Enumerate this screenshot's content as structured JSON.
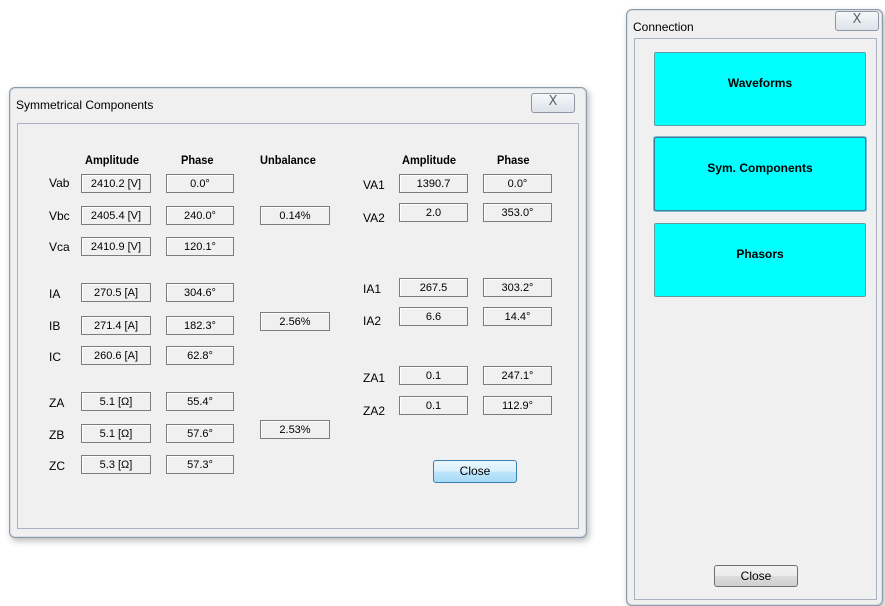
{
  "sym_window": {
    "title": "Symmetrical Components",
    "close_x": "X",
    "headers": {
      "amplitude": "Amplitude",
      "phase": "Phase",
      "unbalance": "Unbalance",
      "amplitude2": "Amplitude",
      "phase2": "Phase"
    },
    "left_rows": [
      {
        "label": "Vab",
        "amplitude": "2410.2 [V]",
        "phase": "0.0°"
      },
      {
        "label": "Vbc",
        "amplitude": "2405.4 [V]",
        "phase": "240.0°"
      },
      {
        "label": "Vca",
        "amplitude": "2410.9 [V]",
        "phase": "120.1°"
      },
      {
        "label": "IA",
        "amplitude": "270.5 [A]",
        "phase": "304.6°"
      },
      {
        "label": "IB",
        "amplitude": "271.4 [A]",
        "phase": "182.3°"
      },
      {
        "label": "IC",
        "amplitude": "260.6 [A]",
        "phase": "62.8°"
      },
      {
        "label": "ZA",
        "amplitude": "5.1 [Ω]",
        "phase": "55.4°"
      },
      {
        "label": "ZB",
        "amplitude": "5.1 [Ω]",
        "phase": "57.6°"
      },
      {
        "label": "ZC",
        "amplitude": "5.3 [Ω]",
        "phase": "57.3°"
      }
    ],
    "unbalance": {
      "voltage": "0.14%",
      "current": "2.56%",
      "impedance": "2.53%"
    },
    "right_rows": [
      {
        "label": "VA1",
        "amplitude": "1390.7",
        "phase": "0.0°"
      },
      {
        "label": "VA2",
        "amplitude": "2.0",
        "phase": "353.0°"
      },
      {
        "label": "IA1",
        "amplitude": "267.5",
        "phase": "303.2°"
      },
      {
        "label": "IA2",
        "amplitude": "6.6",
        "phase": "14.4°"
      },
      {
        "label": "ZA1",
        "amplitude": "0.1",
        "phase": "247.1°"
      },
      {
        "label": "ZA2",
        "amplitude": "0.1",
        "phase": "112.9°"
      }
    ],
    "close_button": "Close"
  },
  "conn_window": {
    "title": "Connection",
    "close_x": "X",
    "buttons": {
      "waveforms": "Waveforms",
      "sym_components": "Sym. Components",
      "phasors": "Phasors"
    },
    "close_button": "Close",
    "accent_color": "#00ffff"
  }
}
